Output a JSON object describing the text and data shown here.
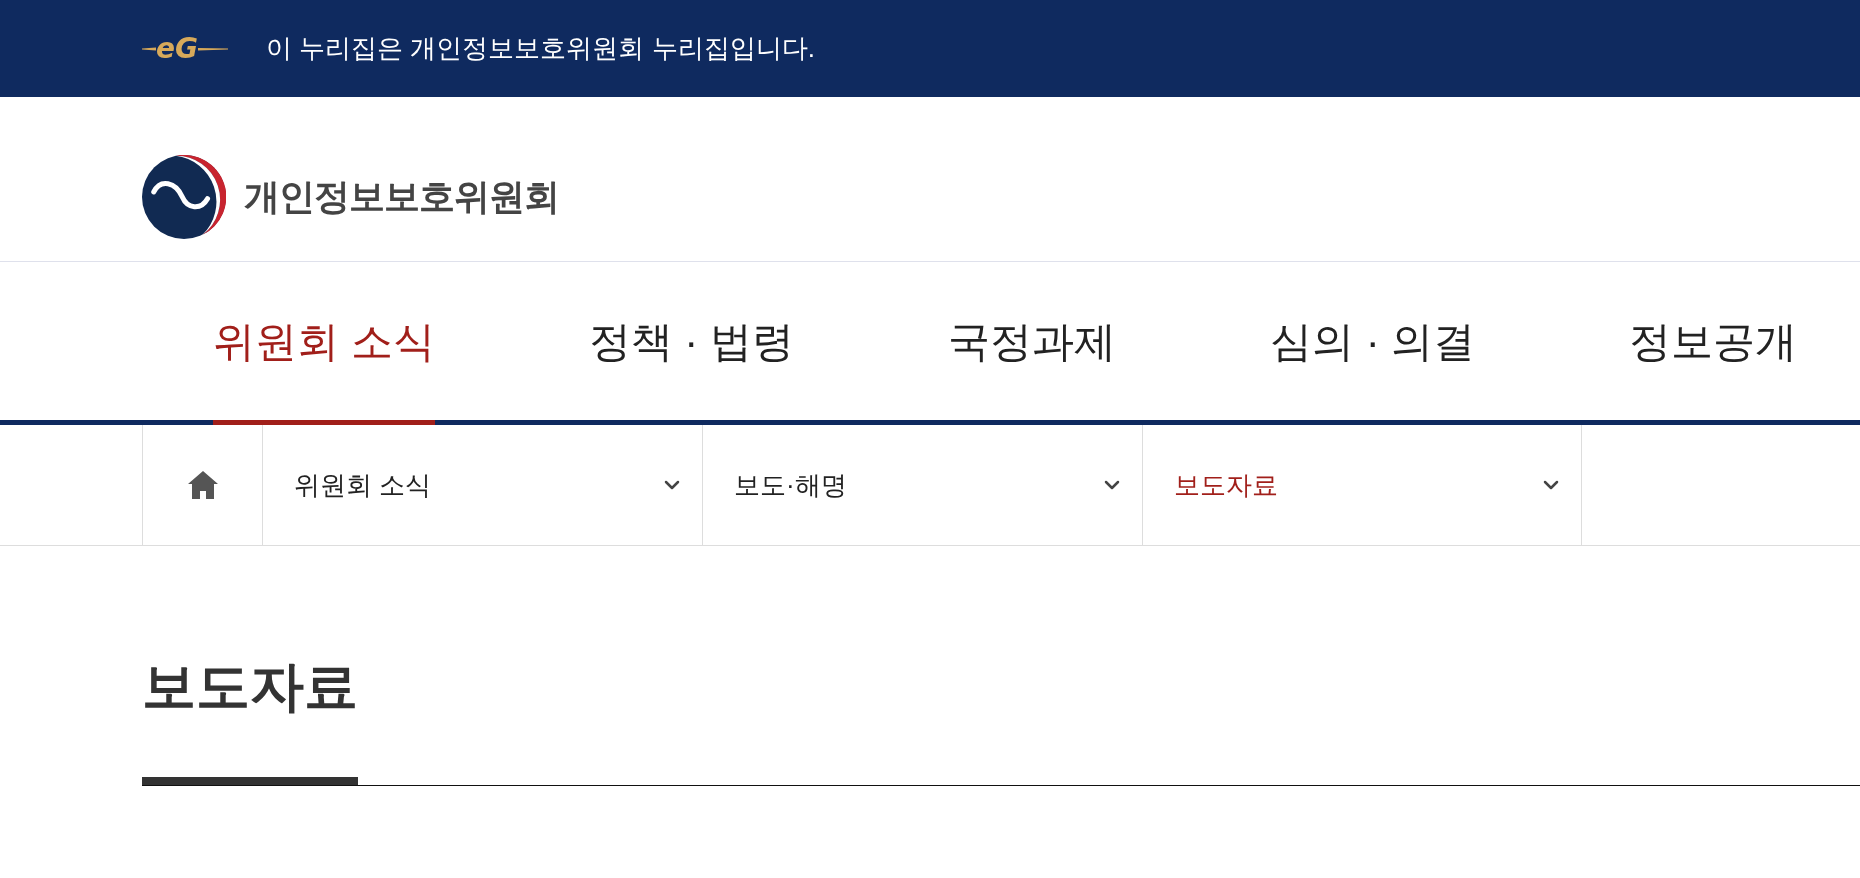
{
  "banner": {
    "logo": "eG",
    "text": "이 누리집은 개인정보보호위원회 누리집입니다."
  },
  "header": {
    "logo_text": "개인정보보호위원회"
  },
  "nav": {
    "items": [
      {
        "label": "위원회 소식",
        "selected": true
      },
      {
        "label": "정책 · 법령",
        "selected": false
      },
      {
        "label": "국정과제",
        "selected": false
      },
      {
        "label": "심의 · 의결",
        "selected": false
      },
      {
        "label": "정보공개",
        "selected": false
      }
    ]
  },
  "breadcrumb": {
    "items": [
      {
        "label": "위원회 소식",
        "selected": false
      },
      {
        "label": "보도·해명",
        "selected": false
      },
      {
        "label": "보도자료",
        "selected": true
      }
    ]
  },
  "page": {
    "title": "보도자료"
  }
}
